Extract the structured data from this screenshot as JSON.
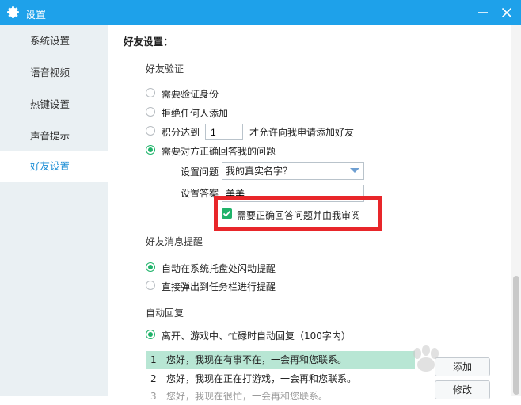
{
  "window": {
    "title": "设置",
    "icons": [
      "gear-icon",
      "minimize-icon",
      "close-icon"
    ]
  },
  "sidebar": {
    "items": [
      {
        "label": "系统设置"
      },
      {
        "label": "语音视频"
      },
      {
        "label": "热键设置"
      },
      {
        "label": "声音提示"
      },
      {
        "label": "好友设置",
        "active": true
      }
    ]
  },
  "friend_settings": {
    "title": "好友设置：",
    "verification": {
      "heading": "好友验证",
      "options": [
        {
          "label": "需要验证身份",
          "selected": false
        },
        {
          "label": "拒绝任何人添加",
          "selected": false
        },
        {
          "label": "积分达到",
          "selected": false
        },
        {
          "label": "需要对方正确回答我的问题",
          "selected": true
        }
      ],
      "points_value": "1",
      "points_suffix": "才允许向我申请添加好友",
      "question_label": "设置问题",
      "question_value": "我的真实名字？",
      "answer_label": "设置答案",
      "answer_value": "美美",
      "review_checkbox_label": "需要正确回答问题并由我审阅",
      "review_checked": true
    },
    "message_alert": {
      "heading": "好友消息提醒",
      "options": [
        {
          "label": "自动在系统托盘处闪动提醒",
          "selected": true
        },
        {
          "label": "直接弹出到任务栏进行提醒",
          "selected": false
        }
      ]
    },
    "auto_reply": {
      "heading": "自动回复",
      "option_label": "离开、游戏中、忙碌时自动回复（100字内）",
      "selected": true,
      "messages": [
        {
          "num": "1",
          "text": "您好，我现在有事不在，一会再和您联系。"
        },
        {
          "num": "2",
          "text": "您好，我现在正在打游戏，一会再和您联系。"
        },
        {
          "num": "3",
          "text": "您好，我现在很忙，一会再和您联系。"
        }
      ],
      "add_button": "添加",
      "edit_button": "修改"
    }
  },
  "colors": {
    "titlebar": "#1ea1ea",
    "accent_green": "#1fb36a",
    "highlight_red": "#e8262a",
    "selected_row": "#b8e6d4"
  }
}
